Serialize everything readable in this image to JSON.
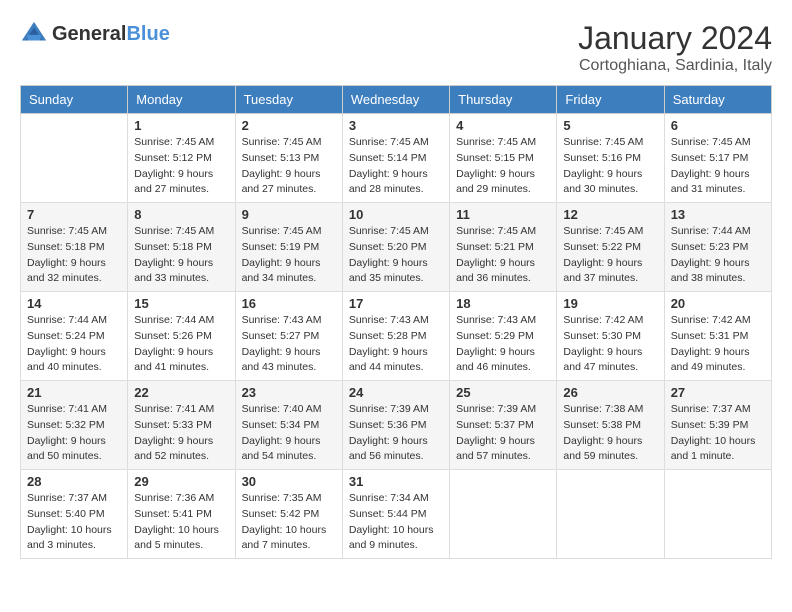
{
  "header": {
    "logo_general": "General",
    "logo_blue": "Blue",
    "month_title": "January 2024",
    "location": "Cortoghiana, Sardinia, Italy"
  },
  "days_of_week": [
    "Sunday",
    "Monday",
    "Tuesday",
    "Wednesday",
    "Thursday",
    "Friday",
    "Saturday"
  ],
  "weeks": [
    [
      {
        "day": "",
        "sunrise": "",
        "sunset": "",
        "daylight": ""
      },
      {
        "day": "1",
        "sunrise": "Sunrise: 7:45 AM",
        "sunset": "Sunset: 5:12 PM",
        "daylight": "Daylight: 9 hours and 27 minutes."
      },
      {
        "day": "2",
        "sunrise": "Sunrise: 7:45 AM",
        "sunset": "Sunset: 5:13 PM",
        "daylight": "Daylight: 9 hours and 27 minutes."
      },
      {
        "day": "3",
        "sunrise": "Sunrise: 7:45 AM",
        "sunset": "Sunset: 5:14 PM",
        "daylight": "Daylight: 9 hours and 28 minutes."
      },
      {
        "day": "4",
        "sunrise": "Sunrise: 7:45 AM",
        "sunset": "Sunset: 5:15 PM",
        "daylight": "Daylight: 9 hours and 29 minutes."
      },
      {
        "day": "5",
        "sunrise": "Sunrise: 7:45 AM",
        "sunset": "Sunset: 5:16 PM",
        "daylight": "Daylight: 9 hours and 30 minutes."
      },
      {
        "day": "6",
        "sunrise": "Sunrise: 7:45 AM",
        "sunset": "Sunset: 5:17 PM",
        "daylight": "Daylight: 9 hours and 31 minutes."
      }
    ],
    [
      {
        "day": "7",
        "sunrise": "Sunrise: 7:45 AM",
        "sunset": "Sunset: 5:18 PM",
        "daylight": "Daylight: 9 hours and 32 minutes."
      },
      {
        "day": "8",
        "sunrise": "Sunrise: 7:45 AM",
        "sunset": "Sunset: 5:18 PM",
        "daylight": "Daylight: 9 hours and 33 minutes."
      },
      {
        "day": "9",
        "sunrise": "Sunrise: 7:45 AM",
        "sunset": "Sunset: 5:19 PM",
        "daylight": "Daylight: 9 hours and 34 minutes."
      },
      {
        "day": "10",
        "sunrise": "Sunrise: 7:45 AM",
        "sunset": "Sunset: 5:20 PM",
        "daylight": "Daylight: 9 hours and 35 minutes."
      },
      {
        "day": "11",
        "sunrise": "Sunrise: 7:45 AM",
        "sunset": "Sunset: 5:21 PM",
        "daylight": "Daylight: 9 hours and 36 minutes."
      },
      {
        "day": "12",
        "sunrise": "Sunrise: 7:45 AM",
        "sunset": "Sunset: 5:22 PM",
        "daylight": "Daylight: 9 hours and 37 minutes."
      },
      {
        "day": "13",
        "sunrise": "Sunrise: 7:44 AM",
        "sunset": "Sunset: 5:23 PM",
        "daylight": "Daylight: 9 hours and 38 minutes."
      }
    ],
    [
      {
        "day": "14",
        "sunrise": "Sunrise: 7:44 AM",
        "sunset": "Sunset: 5:24 PM",
        "daylight": "Daylight: 9 hours and 40 minutes."
      },
      {
        "day": "15",
        "sunrise": "Sunrise: 7:44 AM",
        "sunset": "Sunset: 5:26 PM",
        "daylight": "Daylight: 9 hours and 41 minutes."
      },
      {
        "day": "16",
        "sunrise": "Sunrise: 7:43 AM",
        "sunset": "Sunset: 5:27 PM",
        "daylight": "Daylight: 9 hours and 43 minutes."
      },
      {
        "day": "17",
        "sunrise": "Sunrise: 7:43 AM",
        "sunset": "Sunset: 5:28 PM",
        "daylight": "Daylight: 9 hours and 44 minutes."
      },
      {
        "day": "18",
        "sunrise": "Sunrise: 7:43 AM",
        "sunset": "Sunset: 5:29 PM",
        "daylight": "Daylight: 9 hours and 46 minutes."
      },
      {
        "day": "19",
        "sunrise": "Sunrise: 7:42 AM",
        "sunset": "Sunset: 5:30 PM",
        "daylight": "Daylight: 9 hours and 47 minutes."
      },
      {
        "day": "20",
        "sunrise": "Sunrise: 7:42 AM",
        "sunset": "Sunset: 5:31 PM",
        "daylight": "Daylight: 9 hours and 49 minutes."
      }
    ],
    [
      {
        "day": "21",
        "sunrise": "Sunrise: 7:41 AM",
        "sunset": "Sunset: 5:32 PM",
        "daylight": "Daylight: 9 hours and 50 minutes."
      },
      {
        "day": "22",
        "sunrise": "Sunrise: 7:41 AM",
        "sunset": "Sunset: 5:33 PM",
        "daylight": "Daylight: 9 hours and 52 minutes."
      },
      {
        "day": "23",
        "sunrise": "Sunrise: 7:40 AM",
        "sunset": "Sunset: 5:34 PM",
        "daylight": "Daylight: 9 hours and 54 minutes."
      },
      {
        "day": "24",
        "sunrise": "Sunrise: 7:39 AM",
        "sunset": "Sunset: 5:36 PM",
        "daylight": "Daylight: 9 hours and 56 minutes."
      },
      {
        "day": "25",
        "sunrise": "Sunrise: 7:39 AM",
        "sunset": "Sunset: 5:37 PM",
        "daylight": "Daylight: 9 hours and 57 minutes."
      },
      {
        "day": "26",
        "sunrise": "Sunrise: 7:38 AM",
        "sunset": "Sunset: 5:38 PM",
        "daylight": "Daylight: 9 hours and 59 minutes."
      },
      {
        "day": "27",
        "sunrise": "Sunrise: 7:37 AM",
        "sunset": "Sunset: 5:39 PM",
        "daylight": "Daylight: 10 hours and 1 minute."
      }
    ],
    [
      {
        "day": "28",
        "sunrise": "Sunrise: 7:37 AM",
        "sunset": "Sunset: 5:40 PM",
        "daylight": "Daylight: 10 hours and 3 minutes."
      },
      {
        "day": "29",
        "sunrise": "Sunrise: 7:36 AM",
        "sunset": "Sunset: 5:41 PM",
        "daylight": "Daylight: 10 hours and 5 minutes."
      },
      {
        "day": "30",
        "sunrise": "Sunrise: 7:35 AM",
        "sunset": "Sunset: 5:42 PM",
        "daylight": "Daylight: 10 hours and 7 minutes."
      },
      {
        "day": "31",
        "sunrise": "Sunrise: 7:34 AM",
        "sunset": "Sunset: 5:44 PM",
        "daylight": "Daylight: 10 hours and 9 minutes."
      },
      {
        "day": "",
        "sunrise": "",
        "sunset": "",
        "daylight": ""
      },
      {
        "day": "",
        "sunrise": "",
        "sunset": "",
        "daylight": ""
      },
      {
        "day": "",
        "sunrise": "",
        "sunset": "",
        "daylight": ""
      }
    ]
  ]
}
